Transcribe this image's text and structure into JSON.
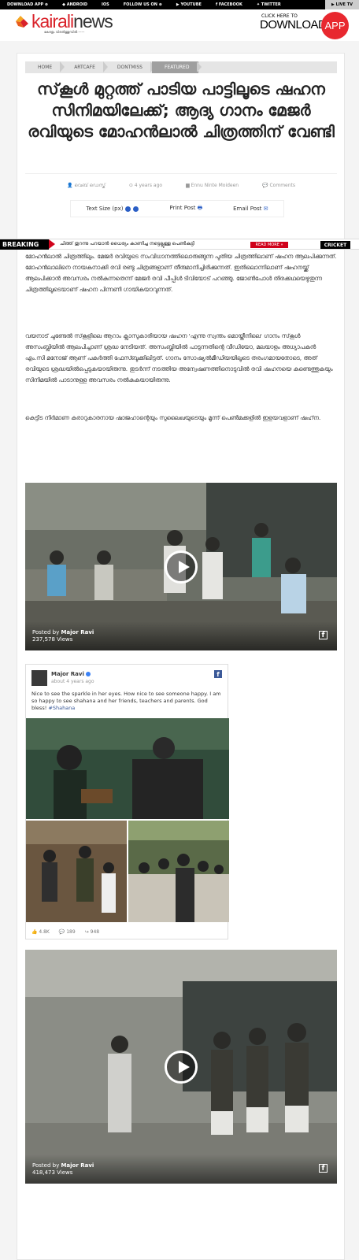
{
  "topbar": {
    "items": [
      "DOWNLOAD APP ⊕",
      "◆ ANDROID",
      " IOS",
      "FOLLOW US ON ⊕",
      "▶ YOUTUBE",
      "f FACEBOOK",
      "✦ TWITTER"
    ],
    "live": "▶ LIVE TV"
  },
  "header": {
    "logo_a": "kairali",
    "logo_b": "news",
    "tagline": "കേരളം വിരൽത്തുമ്പിൽ ——",
    "dl_line1": "CLICK HERE TO",
    "dl_line2": "DOWNLOAD",
    "dl_app": "APP"
  },
  "breadcrumb": [
    "HOME",
    "ARTCAFE",
    "DONTMISS",
    "FEATURED"
  ],
  "article": {
    "title": "സ്‌കൂൾ മുറ്റത്ത് പാടിയ പാട്ടിലൂടെ ഷഹന സിനിമയിലേക്ക്; ആദ്യ ഗാനം മേജർ രവിയുടെ മോഹൻലാൽ ചിത്രത്തിന് വേണ്ടി",
    "author": "👤 വെബ് ഡെസ്ക്",
    "date": "⊙ 4 years ago",
    "tags": "▆ Ennu Ninte Moideen",
    "comments": "💬 Comments",
    "text_size": "Text Size (px)",
    "print": "Print Post",
    "email": "Email Post",
    "para1": "മോഹൻലാൽ ചിത്രത്തിലും. മേജർ രവിയുടെ സംവിധാനത്തിലൊരുങ്ങുന്ന പുതിയ ചിത്രത്തിലാണ് ഷഹന ആലപിക്കുന്നത്. മോഹൻലാലിനെ നായകനാക്കി രവി രണ്ടു ചിത്രങ്ങളാണ് തീരുമാനിച്ചിരിക്കുന്നത്. ഇതിലൊന്നിലാണ് ഷഹനയ്ക്ക് ആലപിക്കാൻ അവസരം നൽകുന്നതെന്ന് മേജർ രവി പീപ്പിൾ ടിവിയോട് പറഞ്ഞു. ജോൺപോൾ തിരക്കഥയെഴുതുന്ന ചിത്രത്തിലൂടെയാണ് ഷഹന പിന്നണി ഗായികയാവുന്നത്.",
    "para2": "വയനാട് ചുണ്ടേൽ സ്‌കൂളിലെ ആറാം ക്ലാസുകാരിയായ ഷഹന 'എന്നു സ്വന്തം മൊയ്തീനിലെ' ഗാനം സ്‌കൂൾ അസംബ്ലിയിൽ ആലപിച്ചാണ് ശ്രദ്ധ നേടിയത്. അസംബ്ലിയിൽ പാടുന്നതിന്റെ വീഡിയോ, മലയാളം അധ്യാപകൻ എം.സി മനോജ് ആണ് പകർത്തി ഫേസ്ബുക്കിലിട്ടത്. ഗാനം സോഷ്യൽമീഡിയയിലൂടെ തരംഗമായതോടെ, അത് രവിയുടെ ശ്രദ്ധയിൽപ്പെടുകയായിരുന്നു. തുടർന്ന് നടത്തിയ അന്വേഷണത്തിനൊടുവിൽ രവി ഷഹനയെ കണ്ടെത്തുകയും സിനിമയിൽ പാടാനുള്ള അവസരം നൽകുകയായിരുന്നു.",
    "para3": "കെട്ടിട നിർമാണ കരാറുകാരനായ ഷാജഹാന്റെയും സുലൈഖയുടെയും മൂന്ന് പെൺമക്കളിൽ ഇളയവളാണ് ഷഹ്‌ന."
  },
  "ticker": {
    "label": "BREAKING",
    "text": "ചിത്ത് തുറന്നു പറയാൻ ധൈര്യം കാണിച്ച നട്ടെല്ലുള്ള പെൺകുട്ടി",
    "more": "READ MORE »",
    "category": "CRICKET"
  },
  "video1": {
    "posted_prefix": "Posted by ",
    "poster": "Major Ravi",
    "views": "237,578 Views",
    "fb": "f"
  },
  "video2": {
    "posted_prefix": "Posted by ",
    "poster": "Major Ravi",
    "views": "418,473 Views",
    "fb": "f"
  },
  "fbpost": {
    "name": "Major Ravi",
    "time": "about 4 years ago",
    "icon": "f",
    "message": "Nice to see the sparkle in her eyes. How nice to see someone happy. I am so happy to see shahana and her friends, teachers and parents. God bless!",
    "hashtag": "#Shahana",
    "likes": "👍 4.8K",
    "comments": "💬 189",
    "shares": "↪ 948"
  }
}
